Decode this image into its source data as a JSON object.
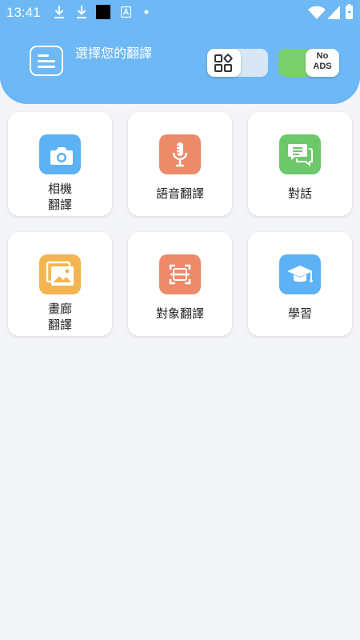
{
  "status_bar": {
    "time": "13:41"
  },
  "header": {
    "title": "選擇您的翻譯",
    "no_ads": "No ADS"
  },
  "cards": [
    {
      "label": "相機\n翻譯",
      "icon": "camera-icon",
      "color": "#5cb2f4"
    },
    {
      "label": "語音翻譯",
      "icon": "microphone-icon",
      "color": "#ec8a6a"
    },
    {
      "label": "對話",
      "icon": "chat-icon",
      "color": "#6cc86a"
    },
    {
      "label": "畫廊\n翻譯",
      "icon": "gallery-icon",
      "color": "#f3b550"
    },
    {
      "label": "對象翻譯",
      "icon": "scan-icon",
      "color": "#ec8a6a"
    },
    {
      "label": "學習",
      "icon": "graduation-cap-icon",
      "color": "#5cb2f4"
    }
  ],
  "colors": {
    "header": "#6db8f5",
    "background": "#f4f5f9",
    "toggle_on": "#7ad06c"
  }
}
